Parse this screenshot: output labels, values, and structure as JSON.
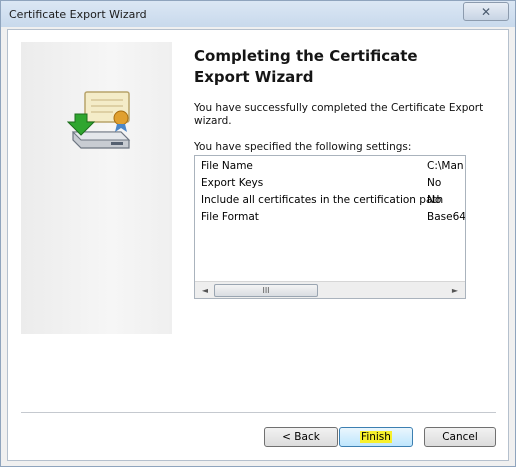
{
  "window": {
    "title": "Certificate Export Wizard",
    "close_glyph": "✕"
  },
  "page": {
    "heading": "Completing the Certificate Export Wizard",
    "description": "You have successfully completed the Certificate Export wizard.",
    "settings_label": "You have specified the following settings:"
  },
  "settings": {
    "rows": [
      {
        "key": "File Name",
        "value": "C:\\Man"
      },
      {
        "key": "Export Keys",
        "value": "No"
      },
      {
        "key": "Include all certificates in the certification path",
        "value": "No"
      },
      {
        "key": "File Format",
        "value": "Base64"
      }
    ],
    "scrollbar": {
      "left_arrow": "◄",
      "right_arrow": "►",
      "thumb_grip": "III"
    }
  },
  "buttons": {
    "back": "< Back",
    "finish": "Finish",
    "cancel": "Cancel"
  },
  "icons": {
    "wizard_icon": "certificate-export-icon",
    "arrow_color": "#2fa62f"
  }
}
